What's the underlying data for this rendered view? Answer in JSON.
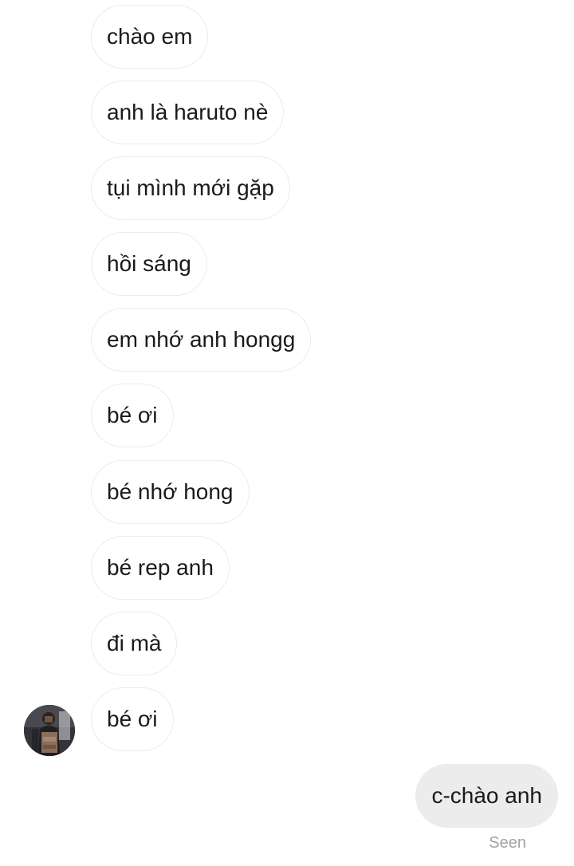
{
  "conversation": {
    "incoming_messages": [
      "chào em",
      "anh là haruto nè",
      "tụi mình mới gặp",
      "hồi sáng",
      "em nhớ anh hongg",
      "bé ơi",
      "bé nhớ hong",
      "bé rep anh",
      "đi mà",
      "bé ơi"
    ],
    "outgoing_messages": [
      "c-chào anh"
    ],
    "status": "Seen"
  },
  "colors": {
    "incoming_bubble_bg": "#ffffff",
    "incoming_bubble_border": "#ebebeb",
    "outgoing_bubble_bg": "#ececec",
    "text": "#1a1a1a",
    "status_text": "#a3a3a3"
  },
  "icons": {
    "sender_avatar": "profile-photo"
  }
}
